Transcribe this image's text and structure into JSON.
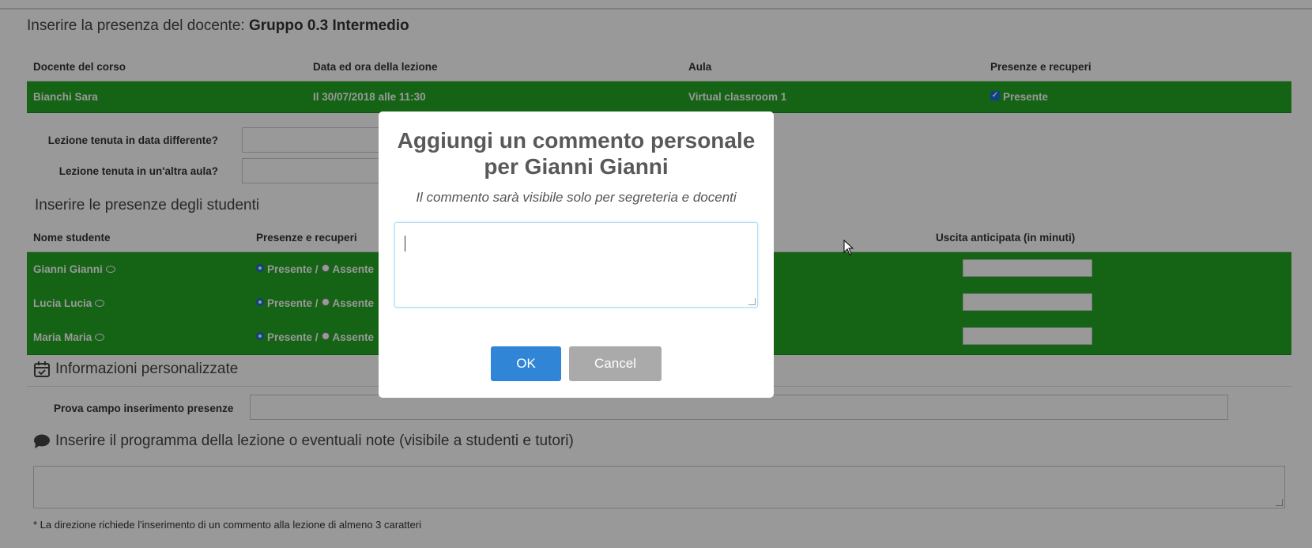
{
  "header": {
    "prefix": "Inserire la presenza del docente:",
    "course": "Gruppo 0.3 Intermedio"
  },
  "teacher_table": {
    "columns": [
      "Docente del corso",
      "Data ed ora della lezione",
      "Aula",
      "Presenze e recuperi"
    ],
    "row": {
      "teacher": "Bianchi Sara",
      "datetime": "Il 30/07/2018 alle 11:30",
      "room": "Virtual classroom 1",
      "presence": "Presente"
    }
  },
  "form": {
    "different_date_label": "Lezione tenuta in data differente?",
    "different_room_label": "Lezione tenuta in un'altra aula?"
  },
  "students_section": {
    "title": "Inserire le presenze degli studenti",
    "columns": [
      "Nome studente",
      "Presenze e recuperi",
      "Uscita anticipata (in minuti)"
    ],
    "present_label": "Presente /",
    "absent_label": "Assente",
    "students": [
      {
        "name": "Gianni Gianni"
      },
      {
        "name": "Lucia Lucia"
      },
      {
        "name": "Maria Maria"
      }
    ]
  },
  "custom_info": {
    "title": "Informazioni personalizzate",
    "field_label": "Prova campo inserimento presenze"
  },
  "notes": {
    "title": "Inserire il programma della lezione o eventuali note (visibile a studenti e tutori)",
    "footnote": "* La direzione richiede l'inserimento di un commento alla lezione di almeno 3 caratteri"
  },
  "modal": {
    "title_line1": "Aggiungi un commento personale",
    "title_line2": "per Gianni Gianni",
    "subtitle": "Il commento sarà visibile solo per segreteria e docenti",
    "ok_label": "OK",
    "cancel_label": "Cancel"
  },
  "colors": {
    "row_green": "#23a523",
    "ok_blue": "#3085d6",
    "cancel_gray": "#aaaaaa"
  }
}
